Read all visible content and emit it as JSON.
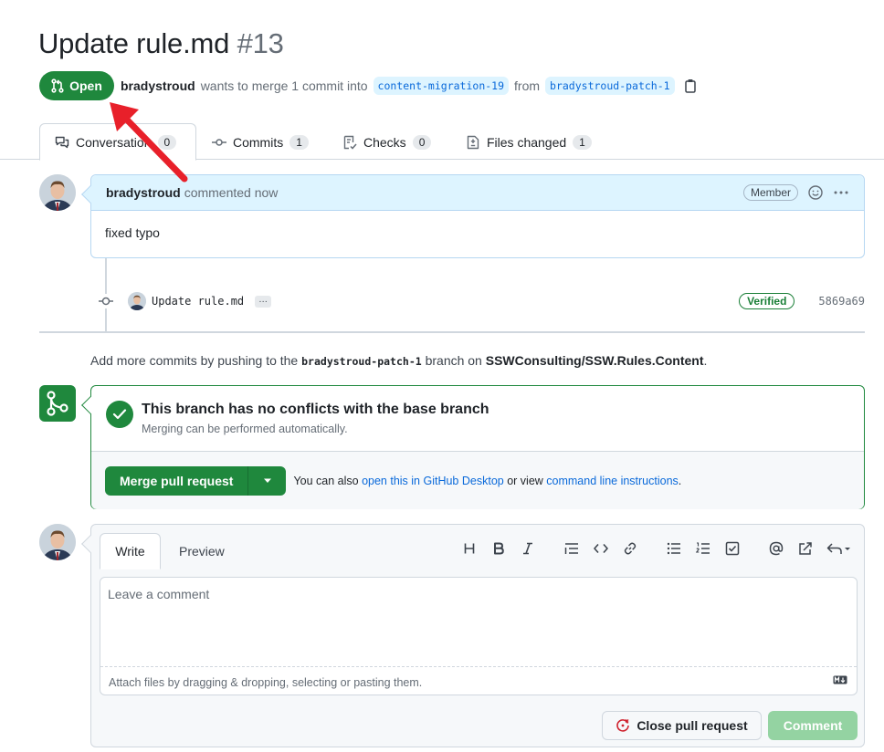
{
  "pr": {
    "title": "Update rule.md",
    "number": "#13",
    "state": "Open",
    "author": "bradystroud",
    "merge_text": "wants to merge 1 commit into",
    "base_branch": "content-migration-19",
    "from_text": "from",
    "head_branch": "bradystroud-patch-1"
  },
  "tabs": [
    {
      "label": "Conversation",
      "count": "0",
      "icon": "comment-discussion-icon"
    },
    {
      "label": "Commits",
      "count": "1",
      "icon": "git-commit-icon"
    },
    {
      "label": "Checks",
      "count": "0",
      "icon": "checklist-icon"
    },
    {
      "label": "Files changed",
      "count": "1",
      "icon": "file-diff-icon"
    }
  ],
  "comment": {
    "author": "bradystroud",
    "action": "commented now",
    "role": "Member",
    "body": "fixed typo"
  },
  "commit": {
    "message": "Update rule.md",
    "more": "…",
    "verified": "Verified",
    "sha": "5869a69"
  },
  "push_hint": {
    "prefix": "Add more commits by pushing to the",
    "branch": "bradystroud-patch-1",
    "middle": "branch on",
    "repo": "SSWConsulting/SSW.Rules.Content",
    "suffix": "."
  },
  "merge": {
    "title": "This branch has no conflicts with the base branch",
    "subtitle": "Merging can be performed automatically.",
    "button": "Merge pull request",
    "alt_prefix": "You can also",
    "alt_link1": "open this in GitHub Desktop",
    "alt_middle": "or view",
    "alt_link2": "command line instructions",
    "alt_suffix": "."
  },
  "editor": {
    "write_tab": "Write",
    "preview_tab": "Preview",
    "placeholder": "Leave a comment",
    "attach_hint": "Attach files by dragging & dropping, selecting or pasting them.",
    "close_button": "Close pull request",
    "comment_button": "Comment",
    "toolbar": [
      "heading-icon",
      "bold-icon",
      "italic-icon",
      "quote-icon",
      "code-icon",
      "link-icon",
      "unordered-list-icon",
      "ordered-list-icon",
      "task-list-icon",
      "mention-icon",
      "cross-reference-icon",
      "reply-icon"
    ]
  },
  "colors": {
    "open_green": "#1f883d",
    "link_blue": "#0969da",
    "annotation_red": "#e8202a"
  }
}
